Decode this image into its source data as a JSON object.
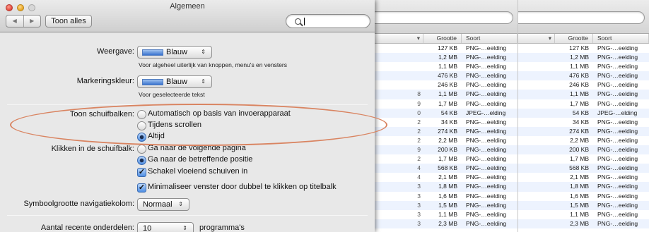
{
  "window": {
    "title": "Algemeen",
    "show_all_label": "Toon alles",
    "back_glyph": "◀",
    "forward_glyph": "▶",
    "search_value": ""
  },
  "appearance": {
    "label": "Weergave:",
    "value": "Blauw",
    "hint": "Voor algeheel uiterlijk van knoppen, menu's en vensters"
  },
  "highlight_color": {
    "label": "Markeringskleur:",
    "value": "Blauw",
    "hint": "Voor geselecteerde tekst"
  },
  "scrollbars": {
    "label": "Toon schuifbalken:",
    "options": [
      {
        "label": "Automatisch op basis van invoerapparaat",
        "selected": false
      },
      {
        "label": "Tijdens scrollen",
        "selected": false
      },
      {
        "label": "Altijd",
        "selected": true
      }
    ]
  },
  "scrollbar_click": {
    "label": "Klikken in de schuifbalk:",
    "options": [
      {
        "label": "Ga naar de volgende pagina",
        "selected": false
      },
      {
        "label": "Ga naar de betreffende positie",
        "selected": true
      }
    ]
  },
  "checkboxes": [
    {
      "label": "Schakel vloeiend schuiven in",
      "checked": true
    },
    {
      "label": "Minimaliseer venster door dubbel te klikken op titelbalk",
      "checked": true
    }
  ],
  "sidebar_icon_size": {
    "label": "Symboolgrootte navigatiekolom:",
    "value": "Normaal"
  },
  "recent_items": {
    "label": "Aantal recente onderdelen:",
    "value": "10",
    "suffix": "programma's"
  },
  "popup_arrows": "⇕",
  "finder_left": {
    "headers": {
      "size": "Grootte",
      "kind": "Soort"
    },
    "rows": [
      {
        "name": "",
        "size": "127 KB",
        "kind": "PNG-…eelding"
      },
      {
        "name": "",
        "size": "1,2 MB",
        "kind": "PNG-…eelding"
      },
      {
        "name": "",
        "size": "1,1 MB",
        "kind": "PNG-…eelding"
      },
      {
        "name": "",
        "size": "476 KB",
        "kind": "PNG-…eelding"
      },
      {
        "name": "",
        "size": "246 KB",
        "kind": "PNG-…eelding"
      },
      {
        "name": "8",
        "size": "1,1 MB",
        "kind": "PNG-…eelding"
      },
      {
        "name": "9",
        "size": "1,7 MB",
        "kind": "PNG-…eelding"
      },
      {
        "name": "0",
        "size": "54 KB",
        "kind": "JPEG-…elding"
      },
      {
        "name": "2",
        "size": "34 KB",
        "kind": "PNG-…eelding"
      },
      {
        "name": "2",
        "size": "274 KB",
        "kind": "PNG-…eelding"
      },
      {
        "name": "2",
        "size": "2,2 MB",
        "kind": "PNG-…eelding"
      },
      {
        "name": "9",
        "size": "200 KB",
        "kind": "PNG-…eelding"
      },
      {
        "name": "2",
        "size": "1,7 MB",
        "kind": "PNG-…eelding"
      },
      {
        "name": "4",
        "size": "568 KB",
        "kind": "PNG-…eelding"
      },
      {
        "name": "4",
        "size": "2,1 MB",
        "kind": "PNG-…eelding"
      },
      {
        "name": "3",
        "size": "1,8 MB",
        "kind": "PNG-…eelding"
      },
      {
        "name": "3",
        "size": "1,6 MB",
        "kind": "PNG-…eelding"
      },
      {
        "name": "3",
        "size": "1,5 MB",
        "kind": "PNG-…eelding"
      },
      {
        "name": "3",
        "size": "1,1 MB",
        "kind": "PNG-…eelding"
      },
      {
        "name": "3",
        "size": "2,3 MB",
        "kind": "PNG-…eelding"
      }
    ]
  },
  "finder_right": {
    "headers": {
      "size": "Grootte",
      "kind": "Soort"
    },
    "rows": [
      {
        "size": "127 KB",
        "kind": "PNG-…eelding"
      },
      {
        "size": "1,2 MB",
        "kind": "PNG-…eelding"
      },
      {
        "size": "1,1 MB",
        "kind": "PNG-…eelding"
      },
      {
        "size": "476 KB",
        "kind": "PNG-…eelding"
      },
      {
        "size": "246 KB",
        "kind": "PNG-…eelding"
      },
      {
        "size": "1,1 MB",
        "kind": "PNG-…eelding"
      },
      {
        "size": "1,7 MB",
        "kind": "PNG-…eelding"
      },
      {
        "size": "54 KB",
        "kind": "JPEG-…elding"
      },
      {
        "size": "34 KB",
        "kind": "PNG-…eelding"
      },
      {
        "size": "274 KB",
        "kind": "PNG-…eelding"
      },
      {
        "size": "2,2 MB",
        "kind": "PNG-…eelding"
      },
      {
        "size": "200 KB",
        "kind": "PNG-…eelding"
      },
      {
        "size": "1,7 MB",
        "kind": "PNG-…eelding"
      },
      {
        "size": "568 KB",
        "kind": "PNG-…eelding"
      },
      {
        "size": "2,1 MB",
        "kind": "PNG-…eelding"
      },
      {
        "size": "1,8 MB",
        "kind": "PNG-…eelding"
      },
      {
        "size": "1,6 MB",
        "kind": "PNG-…eelding"
      },
      {
        "size": "1,5 MB",
        "kind": "PNG-…eelding"
      },
      {
        "size": "1,1 MB",
        "kind": "PNG-…eelding"
      },
      {
        "size": "2,3 MB",
        "kind": "PNG-…eelding"
      }
    ]
  },
  "colors": {
    "accent": "#3a73cf",
    "annotation_ring": "#d98461"
  }
}
